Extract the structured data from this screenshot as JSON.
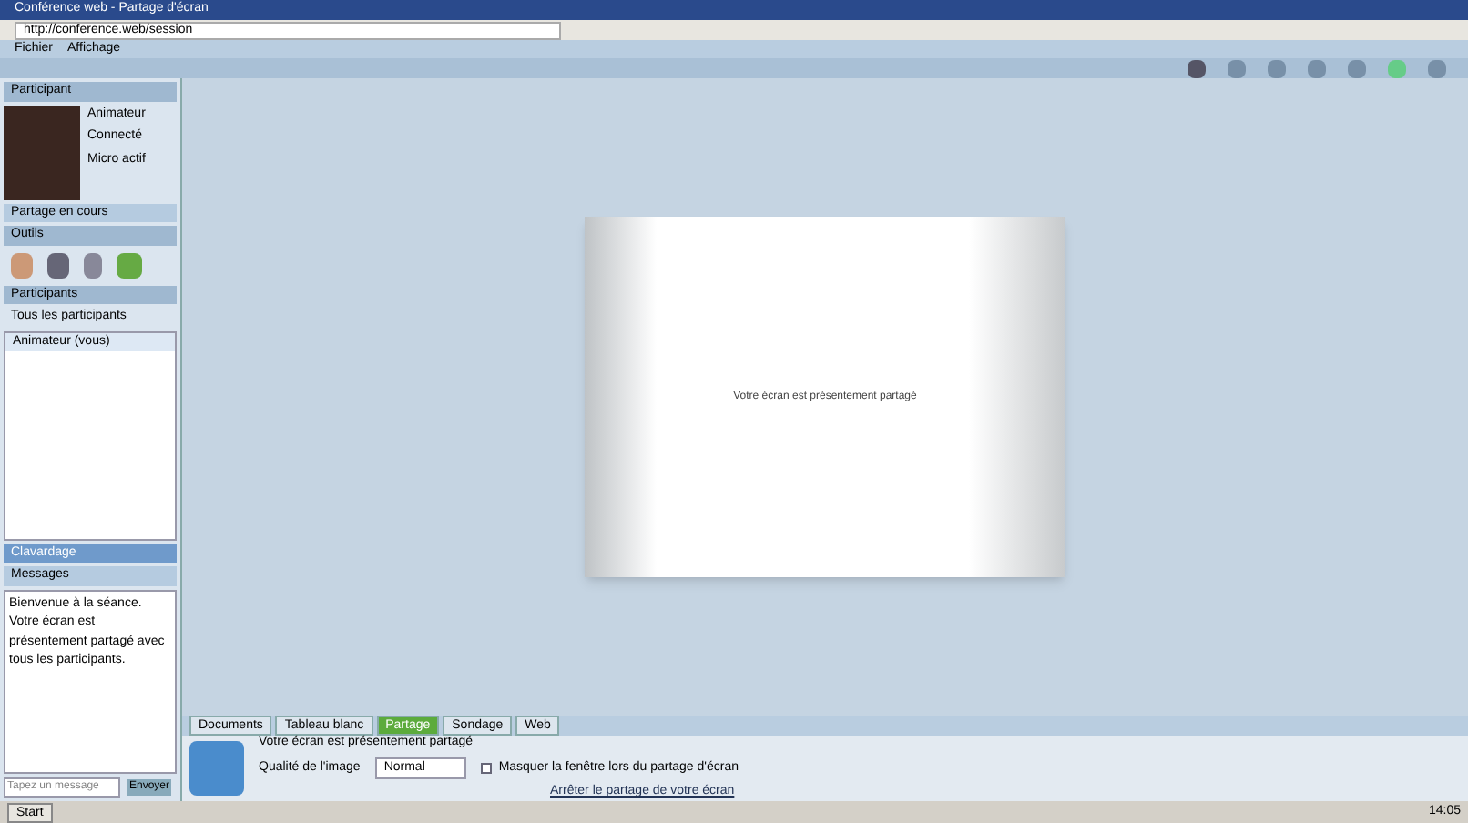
{
  "window": {
    "title": "Conférence web - Partage d'écran"
  },
  "address_bar": {
    "value": "http://conference.web/session"
  },
  "menu": [
    "Fichier",
    "Affichage"
  ],
  "sidebar": {
    "profile": {
      "header": "Participant",
      "lines": [
        "Animateur",
        "Connecté",
        "Micro actif"
      ]
    },
    "status": "Partage en cours",
    "tools_header": "Outils",
    "participants": {
      "header": "Participants",
      "subheader": "Tous les participants",
      "rows": [
        "Animateur (vous)"
      ]
    },
    "chat": {
      "header": "Clavardage",
      "subheader": "Messages",
      "message": "Bienvenue à la séance. Votre écran est présentement partagé avec tous les participants.",
      "input_label": "Envoyer",
      "input_placeholder": "Tapez un message"
    }
  },
  "slide": {
    "text": "Votre écran est présentement partagé"
  },
  "bottom_panel": {
    "tabs": [
      {
        "label": "Documents",
        "selected": false
      },
      {
        "label": "Tableau blanc",
        "selected": false
      },
      {
        "label": "Partage",
        "selected": true
      },
      {
        "label": "Sondage",
        "selected": false
      },
      {
        "label": "Web",
        "selected": false
      }
    ],
    "status": "Votre écran est présentement partagé",
    "quality_label": "Qualité de l'image",
    "quality_value": "Normal",
    "option": {
      "label": "Masquer la fenêtre lors du partage d'écran",
      "checked": false
    },
    "stop_link": "Arrêter le partage de votre écran"
  },
  "taskbar": {
    "start": "Start",
    "clock": "14:05"
  }
}
